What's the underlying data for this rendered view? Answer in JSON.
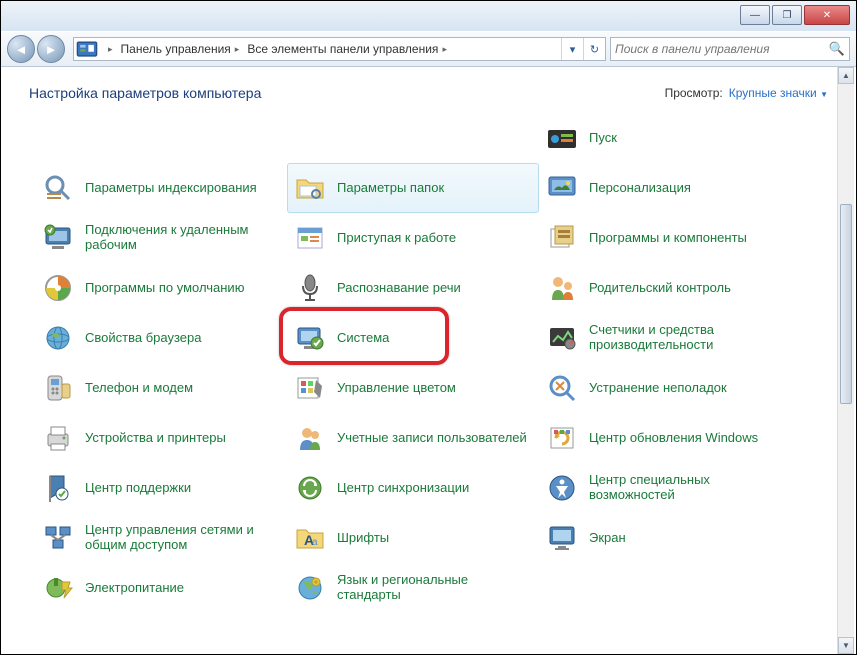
{
  "titlebar": {
    "min": "—",
    "max": "❐",
    "close": "✕"
  },
  "breadcrumb": {
    "seg1": "Панель управления",
    "seg2": "Все элементы панели управления"
  },
  "nav": {
    "dropdown": "▾",
    "refresh": "↻"
  },
  "search": {
    "placeholder": "Поиск в панели управления"
  },
  "header": {
    "title": "Настройка параметров компьютера",
    "view_label": "Просмотр:",
    "view_value": "Крупные значки"
  },
  "items": [
    {
      "label": "",
      "iconKey": "blank"
    },
    {
      "label": "",
      "iconKey": "blank"
    },
    {
      "label": "Пуск",
      "iconKey": "start"
    },
    {
      "label": "Параметры индексирования",
      "iconKey": "search"
    },
    {
      "label": "Параметры папок",
      "iconKey": "folder",
      "hover": true
    },
    {
      "label": "Персонализация",
      "iconKey": "persona"
    },
    {
      "label": "Подключения к удаленным рабочим",
      "iconKey": "remote"
    },
    {
      "label": "Приступая к работе",
      "iconKey": "getstarted"
    },
    {
      "label": "Программы и компоненты",
      "iconKey": "programs"
    },
    {
      "label": "Программы по умолчанию",
      "iconKey": "defaults"
    },
    {
      "label": "Распознавание речи",
      "iconKey": "speech"
    },
    {
      "label": "Родительский контроль",
      "iconKey": "parental"
    },
    {
      "label": "Свойства браузера",
      "iconKey": "inet"
    },
    {
      "label": "Система",
      "iconKey": "system",
      "highlight": true
    },
    {
      "label": "Счетчики и средства производительности",
      "iconKey": "perf"
    },
    {
      "label": "Телефон и модем",
      "iconKey": "phone"
    },
    {
      "label": "Управление цветом",
      "iconKey": "color"
    },
    {
      "label": "Устранение неполадок",
      "iconKey": "trouble"
    },
    {
      "label": "Устройства и принтеры",
      "iconKey": "printers"
    },
    {
      "label": "Учетные записи пользователей",
      "iconKey": "users"
    },
    {
      "label": "Центр обновления Windows",
      "iconKey": "update"
    },
    {
      "label": "Центр поддержки",
      "iconKey": "action"
    },
    {
      "label": "Центр синхронизации",
      "iconKey": "sync"
    },
    {
      "label": "Центр специальных возможностей",
      "iconKey": "ease"
    },
    {
      "label": "Центр управления сетями и общим доступом",
      "iconKey": "network"
    },
    {
      "label": "Шрифты",
      "iconKey": "fonts"
    },
    {
      "label": "Экран",
      "iconKey": "display"
    },
    {
      "label": "Электропитание",
      "iconKey": "power"
    },
    {
      "label": "Язык и региональные стандарты",
      "iconKey": "region"
    }
  ]
}
